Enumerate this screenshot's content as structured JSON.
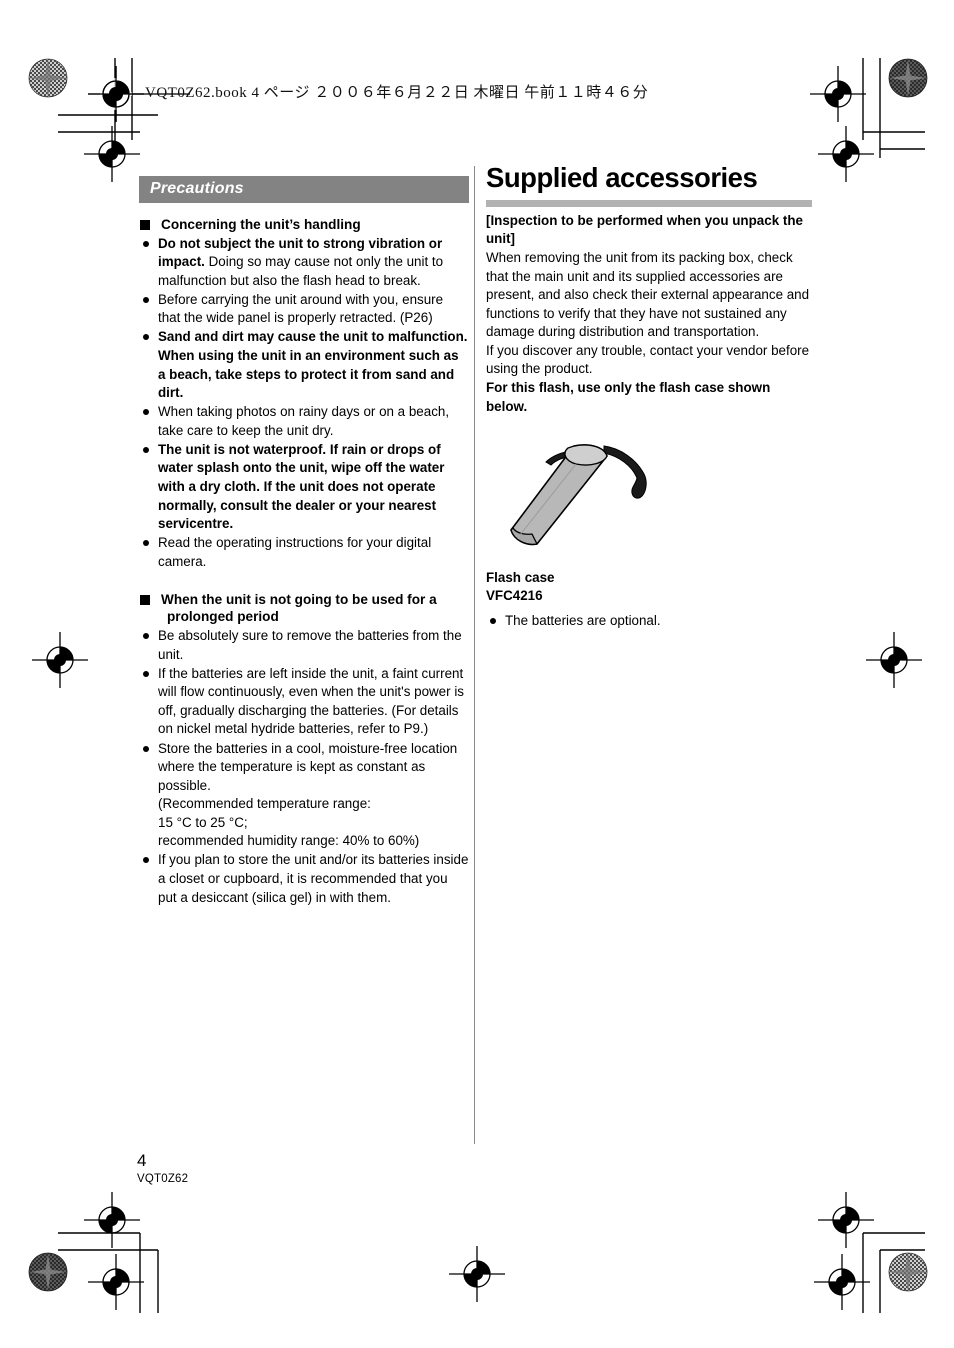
{
  "document": {
    "file_header": "VQT0Z62.book   4 ページ   ２００６年６月２２日   木曜日   午前１１時４６分",
    "footer": {
      "page_number": "4",
      "manual_code": "VQT0Z62"
    }
  },
  "left_column": {
    "section_bar": "Precautions",
    "heading_1": "Concerning the unit’s handling",
    "bullets_1": [
      "Do not subject the unit to strong vibration or impact. Doing so may cause not only the unit to malfunction but also the flash head to break.",
      "Before carrying the unit around with you, ensure that the wide panel is properly retracted. (P26)",
      "Sand and dirt may cause the unit to malfunction. When using the unit in an environment such as a beach, take steps to protect it from sand and dirt.",
      "When taking photos on rainy days or on a beach, take care to keep the unit dry.",
      "The unit is not waterproof. If rain or drops of water splash onto the unit, wipe off the water with a dry cloth. If the unit does not operate normally, consult the dealer or your nearest servicentre.",
      "Read the operating instructions for your digital camera."
    ],
    "bullet_1_lead": "Do not subject the unit to strong vibration or impact.",
    "bullet_1_rest": " Doing so may cause not only the unit to malfunction but also the flash head to break.",
    "heading_2_line1": "When the unit is not going to be used for a",
    "heading_2_line2": "prolonged period",
    "bullets_2": [
      "Be absolutely sure to remove the batteries from the unit.",
      "If the batteries are left inside the unit, a faint current will flow continuously, even when the unit's power is off, gradually discharging the batteries. (For details on nickel metal hydride batteries, refer to P9.)",
      "Store the batteries in a cool, moisture-free location where the temperature is kept as constant as possible.",
      "If you plan to store the unit and/or its batteries inside a closet or cupboard, it is recommended that you put a desiccant (silica gel) in with them."
    ],
    "storage_note_lines": [
      "(Recommended temperature range:",
      "15 °C to 25 °C;",
      "recommended humidity range: 40% to 60%)"
    ]
  },
  "right_column": {
    "title": "Supplied accessories",
    "inspection_heading": "[Inspection to be performed when you unpack the unit]",
    "paragraph_1": "When removing the unit from its packing box, check that the main unit and its supplied accessories are present, and also check their external appearance and functions to verify that they have not sustained any damage during distribution and transportation.",
    "paragraph_2": "If you discover any trouble, contact your vendor before using the product.",
    "paragraph_3_bold": "For this flash, use only the flash case shown below.",
    "figure_name": "flash-case-illustration",
    "caption_line1": "Flash case",
    "caption_line2": "VFC4216",
    "battery_note": "The batteries are optional."
  },
  "colors": {
    "section_bar_bg": "#838383",
    "title_rule": "#b2b2b2",
    "divider": "#8a8a8a",
    "case_body": "#b8b8b8",
    "case_top": "#cfcfcf",
    "case_strap": "#1a1a1a",
    "text": "#000000"
  }
}
